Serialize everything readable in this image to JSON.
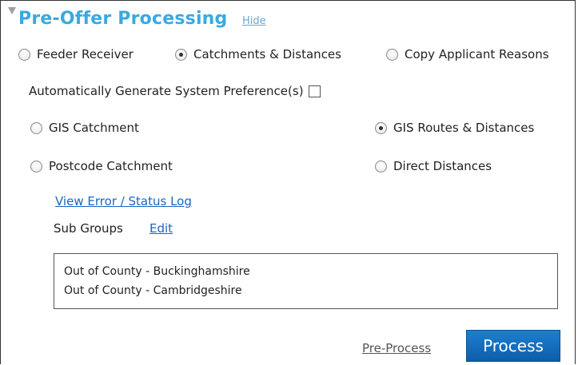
{
  "header": {
    "title": "Pre-Offer Processing",
    "hide_label": "Hide"
  },
  "mode_options": [
    {
      "label": "Feeder Receiver",
      "checked": false
    },
    {
      "label": "Catchments & Distances",
      "checked": true
    },
    {
      "label": "Copy Applicant Reasons",
      "checked": false
    }
  ],
  "auto_generate": {
    "label": "Automatically Generate System Preference(s)",
    "checked": false
  },
  "catchment_options": [
    {
      "label": "GIS Catchment",
      "checked": false
    },
    {
      "label": "Postcode Catchment",
      "checked": false
    }
  ],
  "distance_options": [
    {
      "label": "GIS Routes & Distances",
      "checked": true
    },
    {
      "label": "Direct Distances",
      "checked": false
    }
  ],
  "links": {
    "view_log": "View Error / Status Log",
    "edit": "Edit"
  },
  "sub_groups": {
    "label": "Sub Groups",
    "items": [
      "Out of County - Buckinghamshire",
      "Out of County - Cambridgeshire"
    ]
  },
  "footer": {
    "pre_process": "Pre-Process",
    "process": "Process"
  }
}
